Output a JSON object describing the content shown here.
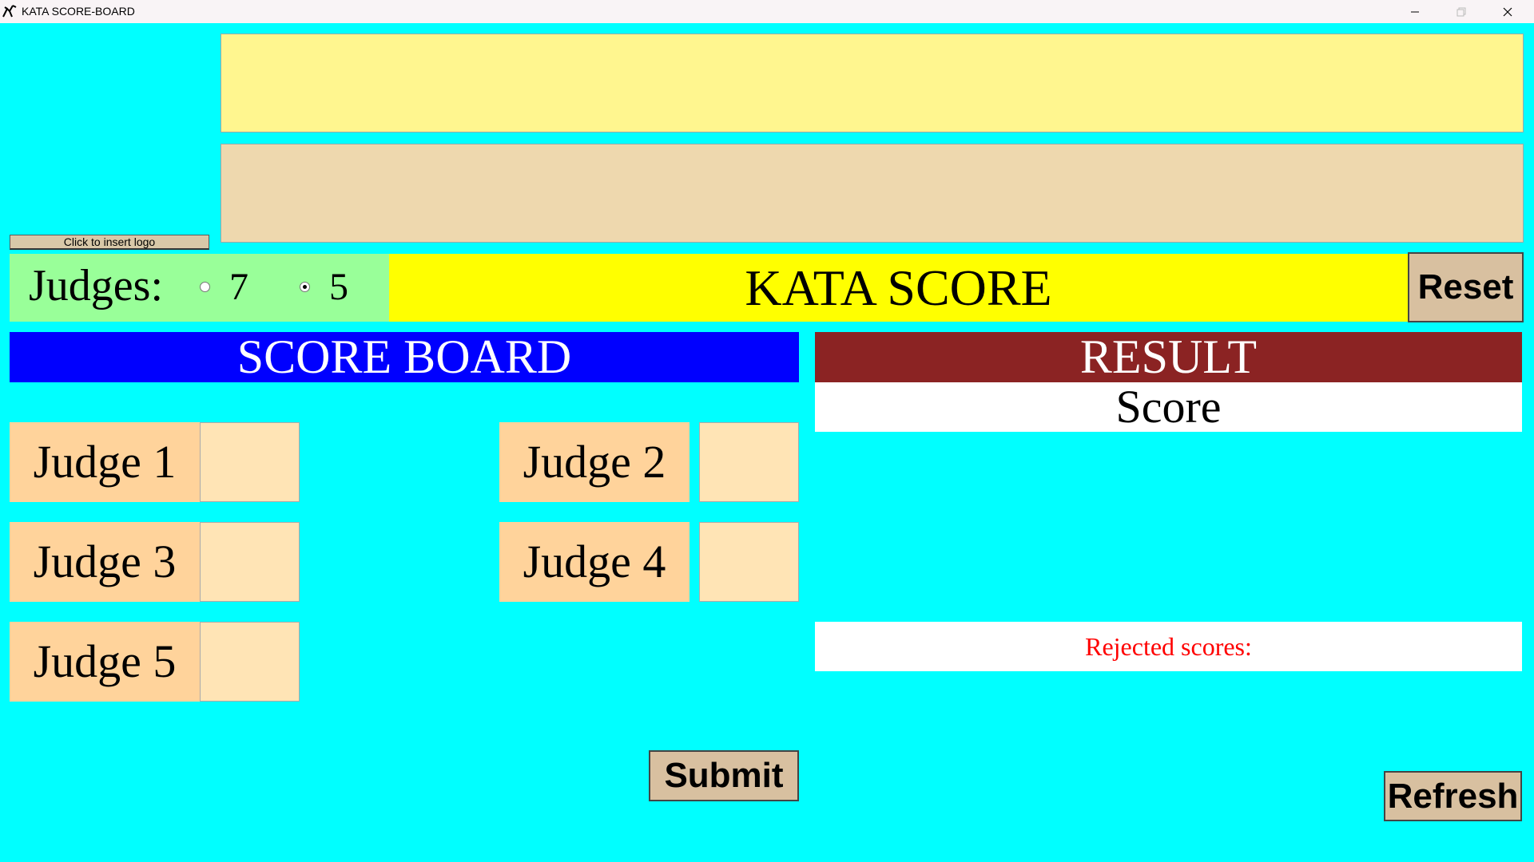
{
  "window": {
    "title": "KATA SCORE-BOARD",
    "controls": [
      "minimize",
      "maximize",
      "close"
    ]
  },
  "header": {
    "event_field_value": "",
    "subtitle_field_value": "",
    "logo_button_label": "Click to insert logo"
  },
  "judges": {
    "label": "Judges:",
    "options": [
      {
        "label": "7",
        "checked": false
      },
      {
        "label": "5",
        "checked": true
      }
    ]
  },
  "kata_title": "KATA SCORE",
  "reset_label": "Reset",
  "scoreboard": {
    "title": "SCORE BOARD",
    "judges": [
      {
        "label": "Judge 1",
        "value": ""
      },
      {
        "label": "Judge 2",
        "value": ""
      },
      {
        "label": "Judge 3",
        "value": ""
      },
      {
        "label": "Judge 4",
        "value": ""
      },
      {
        "label": "Judge 5",
        "value": ""
      }
    ],
    "submit_label": "Submit"
  },
  "result": {
    "title": "RESULT",
    "score_label": "Score",
    "rejected_label": "Rejected scores:",
    "refresh_label": "Refresh"
  },
  "colors": {
    "background": "#00ffff",
    "event_field": "#fff68f",
    "subtitle_field": "#eed8ae",
    "judges_panel": "#99ff99",
    "kata_panel": "#ffff00",
    "scoreboard_title": "#0000ff",
    "result_title": "#8b2323",
    "judge_label": "#ffd39b",
    "judge_input": "#ffe4b5",
    "button": "#d8c0a0",
    "rejected_text": "#ff0000"
  }
}
